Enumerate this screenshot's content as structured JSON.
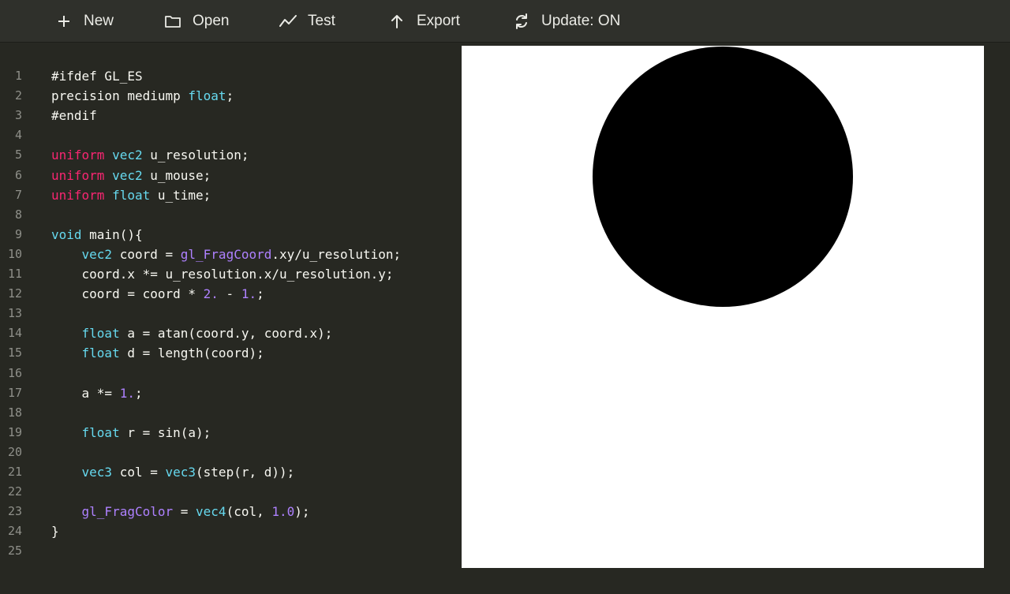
{
  "toolbar": {
    "items": [
      {
        "label": "New",
        "icon": "plus-icon"
      },
      {
        "label": "Open",
        "icon": "folder-icon"
      },
      {
        "label": "Test",
        "icon": "chart-line-icon"
      },
      {
        "label": "Export",
        "icon": "arrow-up-icon"
      },
      {
        "label": "Update: ON",
        "icon": "refresh-icon"
      }
    ]
  },
  "editor": {
    "lines": [
      {
        "n": "1",
        "t": [
          {
            "s": "#ifdef GL_ES",
            "c": ""
          }
        ]
      },
      {
        "n": "2",
        "t": [
          {
            "s": "precision mediump ",
            "c": ""
          },
          {
            "s": "float",
            "c": "cyan"
          },
          {
            "s": ";",
            "c": ""
          }
        ]
      },
      {
        "n": "3",
        "t": [
          {
            "s": "#endif",
            "c": ""
          }
        ]
      },
      {
        "n": "4",
        "t": []
      },
      {
        "n": "5",
        "t": [
          {
            "s": "uniform",
            "c": "red"
          },
          {
            "s": " ",
            "c": ""
          },
          {
            "s": "vec2",
            "c": "cyan"
          },
          {
            "s": " u_resolution;",
            "c": ""
          }
        ]
      },
      {
        "n": "6",
        "t": [
          {
            "s": "uniform",
            "c": "red"
          },
          {
            "s": " ",
            "c": ""
          },
          {
            "s": "vec2",
            "c": "cyan"
          },
          {
            "s": " u_mouse;",
            "c": ""
          }
        ]
      },
      {
        "n": "7",
        "t": [
          {
            "s": "uniform",
            "c": "red"
          },
          {
            "s": " ",
            "c": ""
          },
          {
            "s": "float",
            "c": "cyan"
          },
          {
            "s": " u_time;",
            "c": ""
          }
        ]
      },
      {
        "n": "8",
        "t": []
      },
      {
        "n": "9",
        "t": [
          {
            "s": "void",
            "c": "cyan"
          },
          {
            "s": " main(){",
            "c": ""
          }
        ]
      },
      {
        "n": "10",
        "t": [
          {
            "s": "    ",
            "c": ""
          },
          {
            "s": "vec2",
            "c": "cyan"
          },
          {
            "s": " coord = ",
            "c": ""
          },
          {
            "s": "gl_FragCoord",
            "c": "purple"
          },
          {
            "s": ".xy/u_resolution;",
            "c": ""
          }
        ]
      },
      {
        "n": "11",
        "t": [
          {
            "s": "    coord.x *= u_resolution.x/u_resolution.y;",
            "c": ""
          }
        ]
      },
      {
        "n": "12",
        "t": [
          {
            "s": "    coord = coord * ",
            "c": ""
          },
          {
            "s": "2.",
            "c": "purple"
          },
          {
            "s": " - ",
            "c": ""
          },
          {
            "s": "1.",
            "c": "purple"
          },
          {
            "s": ";",
            "c": ""
          }
        ]
      },
      {
        "n": "13",
        "t": []
      },
      {
        "n": "14",
        "t": [
          {
            "s": "    ",
            "c": ""
          },
          {
            "s": "float",
            "c": "cyan"
          },
          {
            "s": " a = atan(coord.y, coord.x);",
            "c": ""
          }
        ]
      },
      {
        "n": "15",
        "t": [
          {
            "s": "    ",
            "c": ""
          },
          {
            "s": "float",
            "c": "cyan"
          },
          {
            "s": " d = length(coord);",
            "c": ""
          }
        ]
      },
      {
        "n": "16",
        "t": []
      },
      {
        "n": "17",
        "t": [
          {
            "s": "    a *= ",
            "c": ""
          },
          {
            "s": "1.",
            "c": "purple"
          },
          {
            "s": ";",
            "c": ""
          }
        ]
      },
      {
        "n": "18",
        "t": []
      },
      {
        "n": "19",
        "t": [
          {
            "s": "    ",
            "c": ""
          },
          {
            "s": "float",
            "c": "cyan"
          },
          {
            "s": " r = sin(a);",
            "c": ""
          }
        ]
      },
      {
        "n": "20",
        "t": []
      },
      {
        "n": "21",
        "t": [
          {
            "s": "    ",
            "c": ""
          },
          {
            "s": "vec3",
            "c": "cyan"
          },
          {
            "s": " col = ",
            "c": ""
          },
          {
            "s": "vec3",
            "c": "cyan"
          },
          {
            "s": "(step(r, d));",
            "c": ""
          }
        ]
      },
      {
        "n": "22",
        "t": []
      },
      {
        "n": "23",
        "t": [
          {
            "s": "    ",
            "c": ""
          },
          {
            "s": "gl_FragColor",
            "c": "purple"
          },
          {
            "s": " = ",
            "c": ""
          },
          {
            "s": "vec4",
            "c": "cyan"
          },
          {
            "s": "(col, ",
            "c": ""
          },
          {
            "s": "1.0",
            "c": "purple"
          },
          {
            "s": ");",
            "c": ""
          }
        ]
      },
      {
        "n": "24",
        "t": [
          {
            "s": "}",
            "c": ""
          }
        ]
      },
      {
        "n": "25",
        "t": []
      }
    ]
  },
  "colors": {
    "background": "#272822",
    "toolbar": "#2f302b",
    "red": "#f92672",
    "cyan": "#66d9ef",
    "purple": "#ae81ff",
    "text": "#f8f8f2"
  }
}
